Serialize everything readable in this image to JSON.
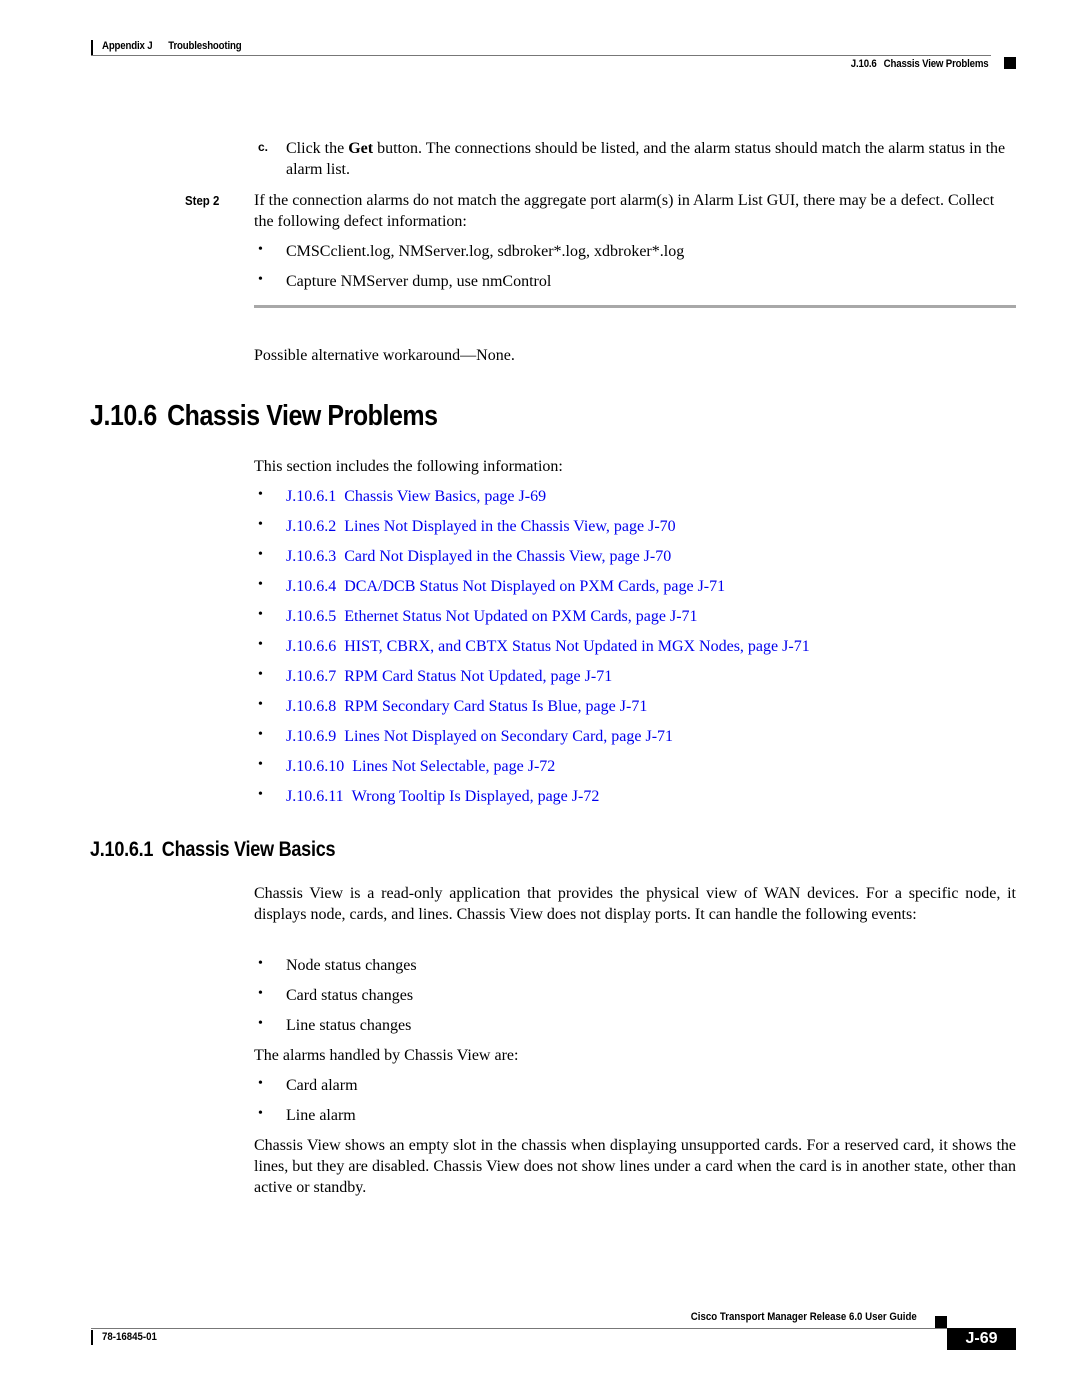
{
  "header": {
    "appendix": "Appendix J",
    "chapter": "Troubleshooting",
    "section_num": "J.10.6",
    "section_title": "Chassis View Problems"
  },
  "steps": {
    "substep_c": {
      "marker": "c.",
      "text_before": "Click the ",
      "bold_word": "Get",
      "text_after": " button. The connections should be listed, and the alarm status should match the alarm status in the alarm list."
    },
    "step2": {
      "label": "Step 2",
      "text": "If the connection alarms do not match the aggregate port alarm(s) in Alarm List GUI, there may be a defect. Collect the following defect information:",
      "bullets": [
        "CMSCclient.log, NMServer.log, sdbroker*.log, xdbroker*.log",
        "Capture NMServer dump, use nmControl"
      ]
    },
    "workaround": "Possible alternative workaround—None."
  },
  "section": {
    "num": "J.10.6",
    "title": "Chassis View Problems",
    "intro": "This section includes the following information:",
    "links": [
      {
        "num": "J.10.6.1",
        "text": "Chassis View Basics, page J-69"
      },
      {
        "num": "J.10.6.2",
        "text": "Lines Not Displayed in the Chassis View, page J-70"
      },
      {
        "num": "J.10.6.3",
        "text": "Card Not Displayed in the Chassis View, page J-70"
      },
      {
        "num": "J.10.6.4",
        "text": "DCA/DCB Status Not Displayed on PXM Cards, page J-71"
      },
      {
        "num": "J.10.6.5",
        "text": "Ethernet Status Not Updated on PXM Cards, page J-71"
      },
      {
        "num": "J.10.6.6",
        "text": "HIST, CBRX, and CBTX Status Not Updated in MGX Nodes, page J-71"
      },
      {
        "num": "J.10.6.7",
        "text": "RPM Card Status Not Updated, page J-71"
      },
      {
        "num": "J.10.6.8",
        "text": "RPM Secondary Card Status Is Blue, page J-71"
      },
      {
        "num": "J.10.6.9",
        "text": "Lines Not Displayed on Secondary Card, page J-71"
      },
      {
        "num": "J.10.6.10",
        "text": "Lines Not Selectable, page J-72"
      },
      {
        "num": "J.10.6.11",
        "text": "Wrong Tooltip Is Displayed, page J-72"
      }
    ]
  },
  "subsection": {
    "num": "J.10.6.1",
    "title": "Chassis View Basics",
    "para1": "Chassis View is a read-only application that provides the physical view of WAN devices. For a specific node, it displays node, cards, and lines. Chassis View does not display ports. It can handle the following events:",
    "events": [
      "Node status changes",
      "Card status changes",
      "Line status changes"
    ],
    "alarms_intro": "The alarms handled by Chassis View are:",
    "alarms": [
      "Card alarm",
      "Line alarm"
    ],
    "para2": "Chassis View shows an empty slot in the chassis when displaying unsupported cards. For a reserved card, it shows the lines, but they are disabled. Chassis View does not show lines under a card when the card is in another state, other than active or standby."
  },
  "footer": {
    "guide_title": "Cisco Transport Manager Release 6.0 User Guide",
    "doc_number": "78-16845-01",
    "page": "J-69"
  },
  "colors": {
    "link": "#0000ee",
    "text": "#000000",
    "divider": "#a8a8a8"
  },
  "icons": {
    "bullet": "•"
  }
}
